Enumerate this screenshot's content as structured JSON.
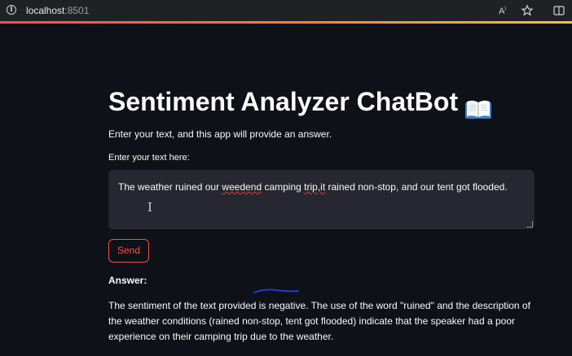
{
  "browser": {
    "url_host": "localhost",
    "url_port": ":8501",
    "icons": [
      "info-icon",
      "read-aloud-icon",
      "favorite-star-icon",
      "split-screen-icon"
    ]
  },
  "app": {
    "title": "Sentiment Analyzer ChatBot",
    "title_emoji": "open-book-icon",
    "subtitle": "Enter your text, and this app will provide an answer.",
    "input_label": "Enter your text here:",
    "input_value_before": "The weather ruined our ",
    "input_value_misspelled_1": "weedend",
    "input_value_middle": " camping ",
    "input_value_misspelled_2": "trip,it",
    "input_value_after": " rained non-stop, and our tent got flooded.",
    "send_label": "Send",
    "answer_label": "Answer:",
    "answer_text": "The sentiment of the text provided is negative. The use of the word \"ruined\" and the description of the weather conditions (rained non-stop, tent got flooded) indicate that the speaker had a poor experience on their camping trip due to the weather."
  },
  "colors": {
    "background": "#0e1117",
    "input_background": "#262730",
    "accent": "#ff4b4b",
    "annotation_stroke": "#1f3bd6"
  }
}
